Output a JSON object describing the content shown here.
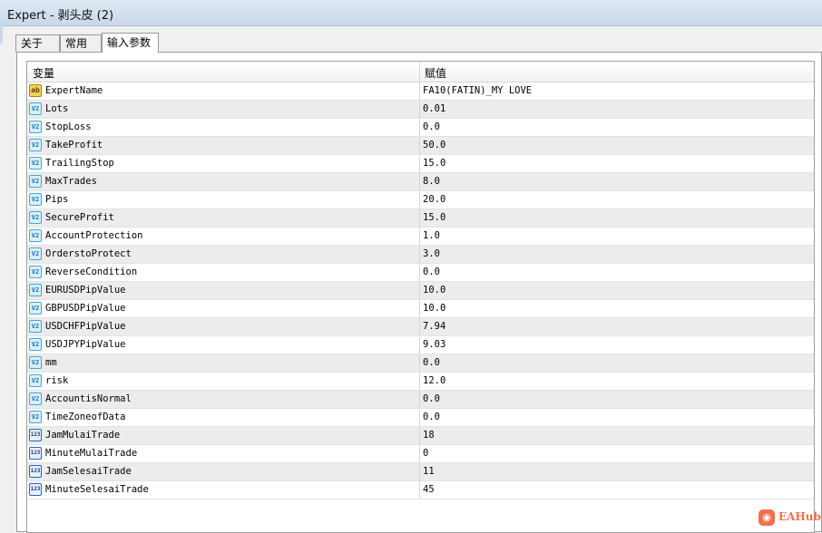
{
  "window": {
    "title": "Expert - 剥头皮 (2)"
  },
  "tabs": [
    {
      "label": "关于"
    },
    {
      "label": "常用"
    },
    {
      "label": "输入参数"
    }
  ],
  "table": {
    "headers": {
      "variable": "变量",
      "value": "赋值"
    },
    "rows": [
      {
        "icon": "ab",
        "name": "ExpertName",
        "value": "FA10(FATIN)_MY LOVE"
      },
      {
        "icon": "v2",
        "name": "Lots",
        "value": "0.01"
      },
      {
        "icon": "v2",
        "name": "StopLoss",
        "value": "0.0"
      },
      {
        "icon": "v2",
        "name": "TakeProfit",
        "value": "50.0"
      },
      {
        "icon": "v2",
        "name": "TrailingStop",
        "value": "15.0"
      },
      {
        "icon": "v2",
        "name": "MaxTrades",
        "value": "8.0"
      },
      {
        "icon": "v2",
        "name": "Pips",
        "value": "20.0"
      },
      {
        "icon": "v2",
        "name": "SecureProfit",
        "value": "15.0"
      },
      {
        "icon": "v2",
        "name": "AccountProtection",
        "value": "1.0"
      },
      {
        "icon": "v2",
        "name": "OrderstoProtect",
        "value": "3.0"
      },
      {
        "icon": "v2",
        "name": "ReverseCondition",
        "value": "0.0"
      },
      {
        "icon": "v2",
        "name": "EURUSDPipValue",
        "value": "10.0"
      },
      {
        "icon": "v2",
        "name": "GBPUSDPipValue",
        "value": "10.0"
      },
      {
        "icon": "v2",
        "name": "USDCHFPipValue",
        "value": "7.94"
      },
      {
        "icon": "v2",
        "name": "USDJPYPipValue",
        "value": "9.03"
      },
      {
        "icon": "v2",
        "name": "mm",
        "value": "0.0"
      },
      {
        "icon": "v2",
        "name": "risk",
        "value": "12.0"
      },
      {
        "icon": "v2",
        "name": "AccountisNormal",
        "value": "0.0"
      },
      {
        "icon": "v2",
        "name": "TimeZoneofData",
        "value": "0.0"
      },
      {
        "icon": "123",
        "name": "JamMulaiTrade",
        "value": "18"
      },
      {
        "icon": "123",
        "name": "MinuteMulaiTrade",
        "value": "0"
      },
      {
        "icon": "123",
        "name": "JamSelesaiTrade",
        "value": "11"
      },
      {
        "icon": "123",
        "name": "MinuteSelesaiTrade",
        "value": "45"
      }
    ]
  },
  "watermark": {
    "text": "EAHub"
  }
}
